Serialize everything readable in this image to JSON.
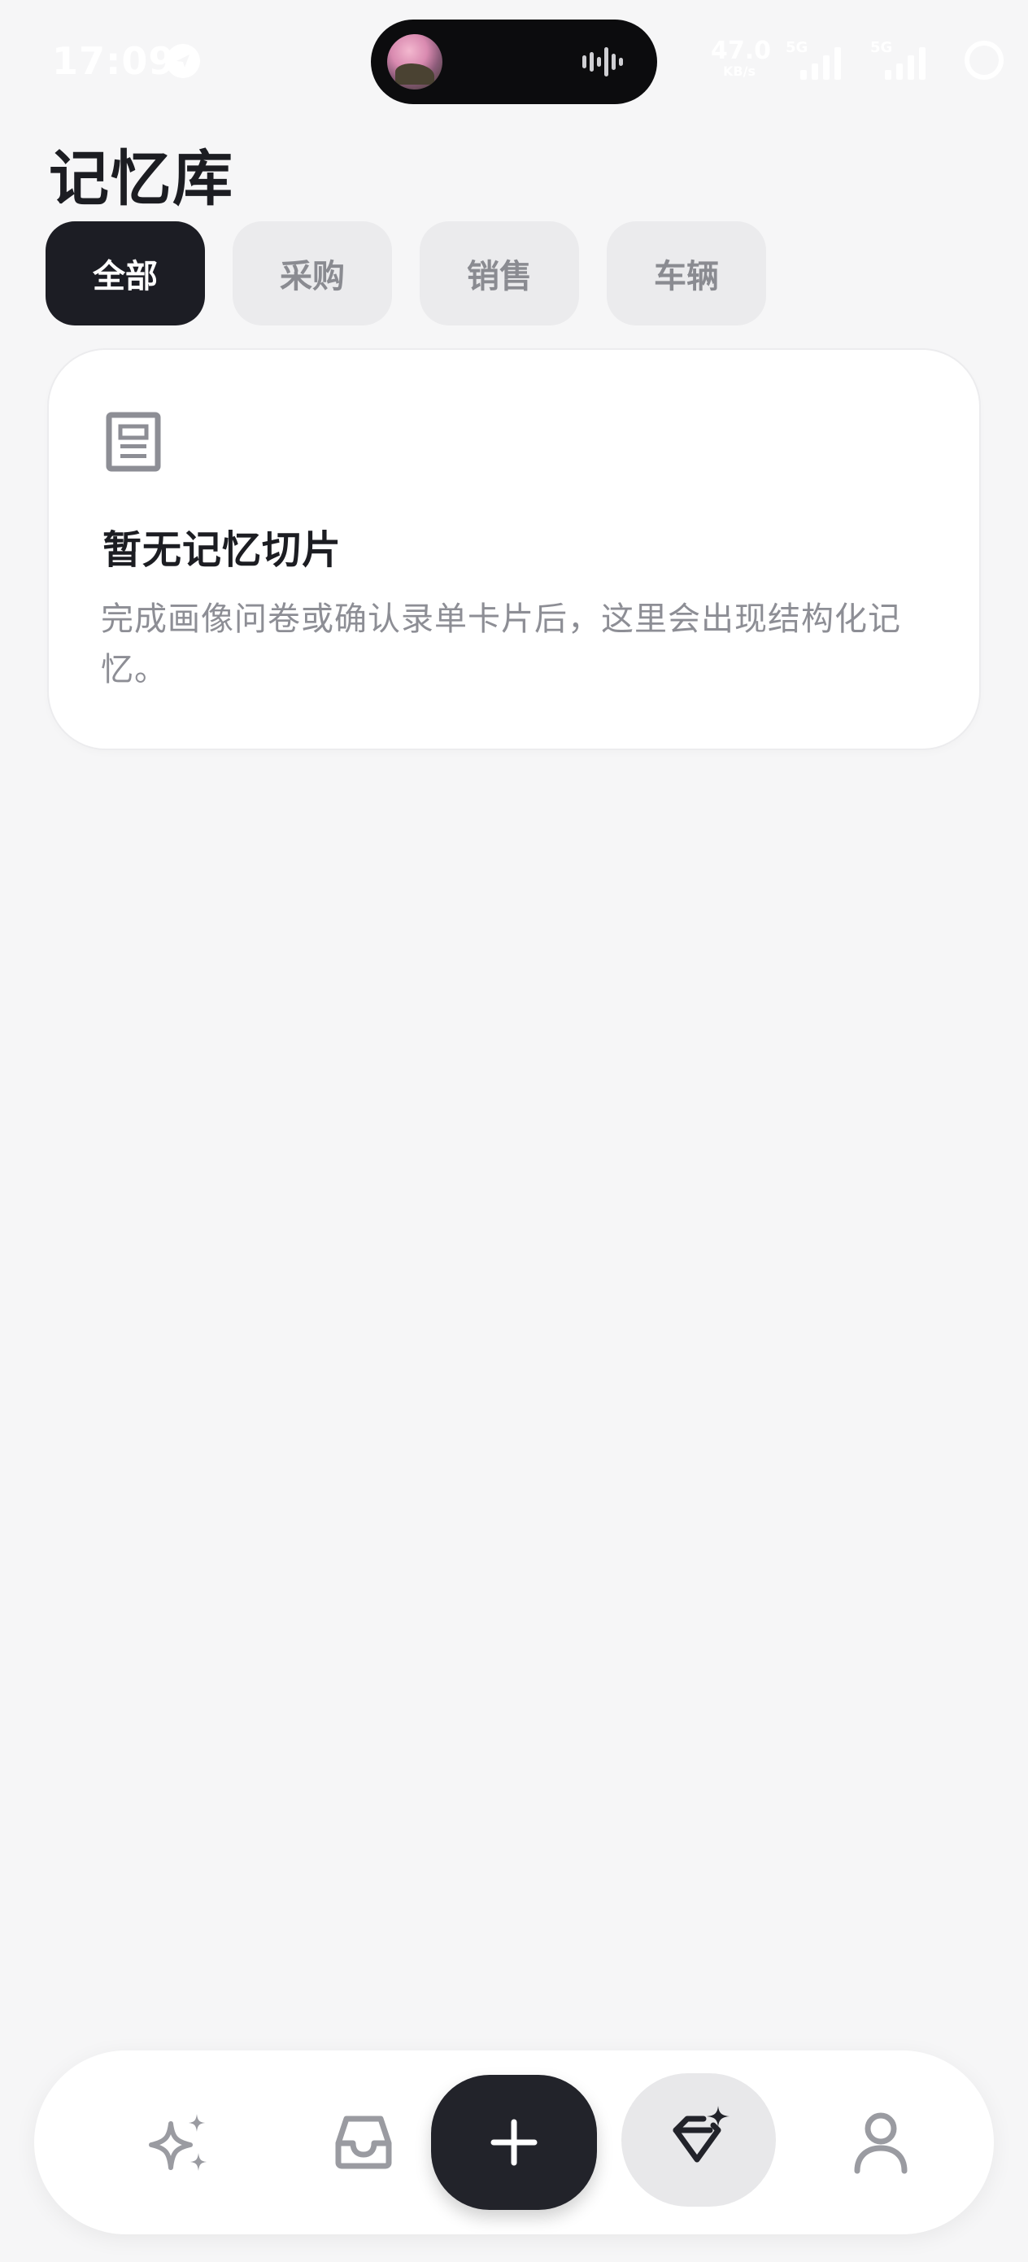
{
  "status_bar": {
    "time": "17:09",
    "net_speed_value": "47.0",
    "net_speed_unit": "KB/s",
    "signal_1_label": "5G",
    "signal_2_label": "5G"
  },
  "header": {
    "title": "记忆库"
  },
  "tabs": [
    {
      "label": "全部",
      "active": true
    },
    {
      "label": "采购",
      "active": false
    },
    {
      "label": "销售",
      "active": false
    },
    {
      "label": "车辆",
      "active": false
    }
  ],
  "empty_state": {
    "icon": "document-icon",
    "title": "暂无记忆切片",
    "description": "完成画像问卷或确认录单卡片后，这里会出现结构化记忆。"
  },
  "bottom_nav": {
    "items": [
      {
        "icon": "sparkle-icon",
        "active": false
      },
      {
        "icon": "inbox-icon",
        "active": false
      },
      {
        "icon": "plus-icon",
        "active": false
      },
      {
        "icon": "diamond-sparkle-icon",
        "active": true
      },
      {
        "icon": "user-icon",
        "active": false
      }
    ]
  },
  "colors": {
    "background": "#f6f6f7",
    "active_tab": "#1c1d24",
    "inactive_tab": "#ebebed",
    "text_primary": "#1c1d22",
    "text_secondary": "#8d8e95",
    "icon_muted": "#9a9ba1"
  }
}
